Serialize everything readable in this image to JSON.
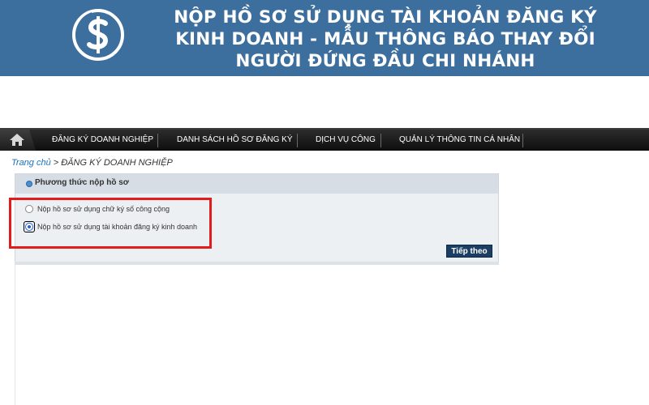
{
  "banner": {
    "title_line1": "NỘP HỒ SƠ SỬ DỤNG TÀI KHOẢN ĐĂNG KÝ",
    "title_line2": "KINH DOANH - MẪU THÔNG BÁO THAY ĐỔI",
    "title_line3": "NGƯỜI ĐỨNG ĐẦU CHI NHÁNH",
    "logo_icon": "dollar-coin-logo",
    "background_color": "#3c6e9e"
  },
  "navbar": {
    "home_icon": "home-icon",
    "items": [
      {
        "label": "ĐĂNG KÝ DOANH NGHIỆP"
      },
      {
        "label": "DANH SÁCH HỒ SƠ ĐĂNG KÝ"
      },
      {
        "label": "DỊCH VỤ CÔNG"
      },
      {
        "label": "QUẢN LÝ THÔNG TIN CÁ NHÂN"
      }
    ]
  },
  "breadcrumb": {
    "home": "Trang chủ",
    "separator": " > ",
    "current": "ĐĂNG KÝ DOANH NGHIỆP"
  },
  "panel": {
    "title": "Phương thức nộp hồ sơ",
    "options": [
      {
        "label": "Nộp hồ sơ sử dụng chữ ký số công cộng",
        "checked": false
      },
      {
        "label": "Nộp hồ sơ sử dụng tài khoản đăng ký kinh doanh",
        "checked": true
      }
    ],
    "next_button": "Tiếp theo",
    "highlight_color": "#e21c1c"
  }
}
